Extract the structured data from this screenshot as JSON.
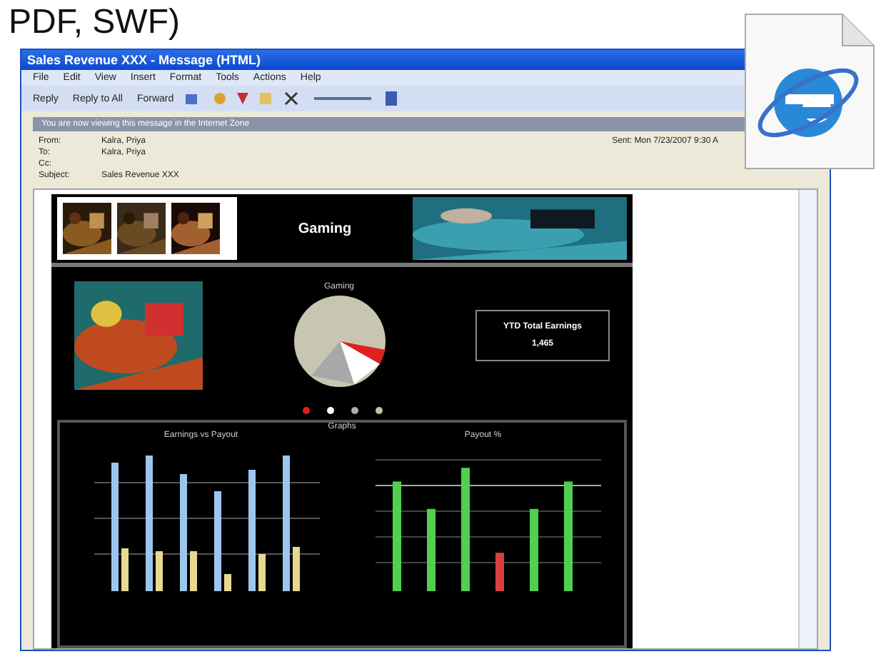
{
  "caption": "PDF, SWF)",
  "window": {
    "title": "Sales Revenue XXX - Message (HTML)"
  },
  "menu": [
    "File",
    "Edit",
    "View",
    "Insert",
    "Format",
    "Tools",
    "Actions",
    "Help"
  ],
  "toolbar": [
    "Reply",
    "Reply to All",
    "Forward"
  ],
  "info_bar": "You are now viewing this message in the Internet Zone",
  "header": {
    "fields": [
      {
        "label": "From:",
        "value": "Kalra, Priya"
      },
      {
        "label": "To:",
        "value": "Kalra, Priya"
      },
      {
        "label": "Cc:"
      },
      {
        "label": "Subject:",
        "value": "Sales Revenue XXX"
      }
    ],
    "sent_label": "Sent:",
    "sent_value": "Mon 7/23/2007 9:30 A"
  },
  "body": {
    "banner_title": "Gaming",
    "pie_title": "Gaming",
    "kpi_title": "YTD Total Earnings",
    "kpi_value": "1,465",
    "legend": [
      {
        "color": "#e02020"
      },
      {
        "color": "#ffffff"
      },
      {
        "color": "#b0b0b0"
      },
      {
        "color": "#c8c39a"
      }
    ],
    "graphs_title": "Graphs",
    "chart_titles": [
      "Earnings vs Payout",
      "Payout %"
    ]
  }
}
